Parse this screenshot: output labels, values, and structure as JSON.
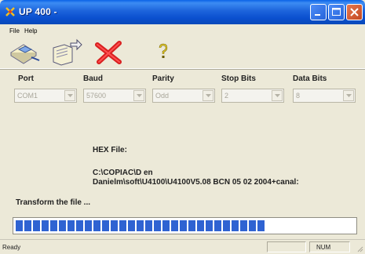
{
  "window": {
    "title": "UP 400 -",
    "icon": "app-icon"
  },
  "title_buttons": [
    "minimize-icon",
    "maximize-icon",
    "close-icon"
  ],
  "menu": [
    {
      "label": "File"
    },
    {
      "label": "Help"
    }
  ],
  "toolbar": [
    {
      "name": "connect-icon"
    },
    {
      "name": "open-file-icon"
    },
    {
      "name": "cancel-icon"
    },
    {
      "name": "help-icon"
    }
  ],
  "settings": {
    "port": {
      "label": "Port",
      "value": "COM1"
    },
    "baud": {
      "label": "Baud",
      "value": "57600"
    },
    "parity": {
      "label": "Parity",
      "value": "Odd"
    },
    "stop_bits": {
      "label": "Stop Bits",
      "value": "2"
    },
    "data_bits": {
      "label": "Data Bits",
      "value": "8"
    }
  },
  "hex_file": {
    "label": "HEX File:",
    "path_line1": "C:\\COPIAC\\D en",
    "path_line2": "Danielm\\soft\\U4100\\U4100V5.08  BCN  05  02  2004+canal:"
  },
  "transform_label": "Transform the file ...",
  "progress": {
    "fraction": 0.76,
    "color": "#2F63D2"
  },
  "status": {
    "text": "Ready",
    "num": "NUM"
  }
}
